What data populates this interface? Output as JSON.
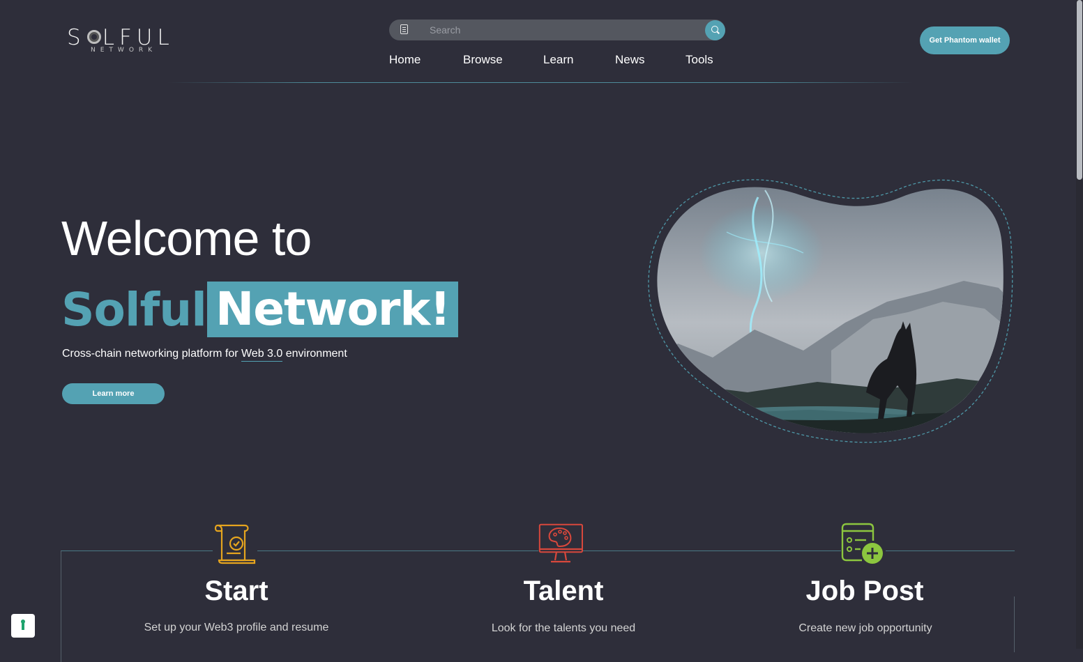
{
  "brand": {
    "name": "SOLFUL",
    "sub": "NETWORK"
  },
  "search": {
    "placeholder": "Search",
    "doc_icon": "document-icon",
    "button_icon": "search-icon"
  },
  "nav": [
    {
      "label": "Home"
    },
    {
      "label": "Browse"
    },
    {
      "label": "Learn"
    },
    {
      "label": "News"
    },
    {
      "label": "Tools"
    }
  ],
  "wallet_button": "Get Phantom wallet",
  "hero": {
    "line1": "Welcome to",
    "line2_a": "Solful",
    "line2_b": "Network!",
    "tagline_pre": "Cross-chain networking platform for ",
    "tagline_hl": "Web 3.0",
    "tagline_post": " environment",
    "cta": "Learn more",
    "image": "fantasy-landscape-illustration"
  },
  "features": [
    {
      "title": "Start",
      "desc": "Set up your Web3 profile and resume",
      "icon": "scroll-check-icon",
      "color": "#e6a51e"
    },
    {
      "title": "Talent",
      "desc": "Look for the talents you need",
      "icon": "monitor-palette-icon",
      "color": "#d9483c"
    },
    {
      "title": "Job Post",
      "desc": "Create new job opportunity",
      "icon": "list-add-icon",
      "color": "#8cc63f"
    }
  ],
  "colors": {
    "background": "#2e2e3a",
    "accent": "#54a2b3"
  },
  "password_manager_icon": "keyhole-icon"
}
